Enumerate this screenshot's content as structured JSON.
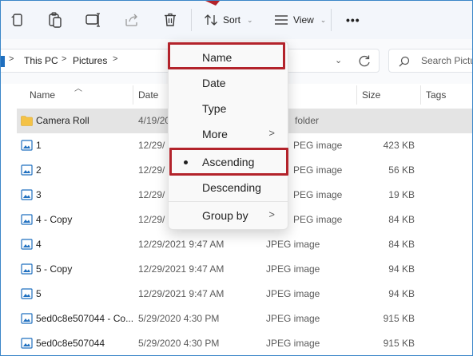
{
  "toolbar": {
    "icons": [
      "copy-icon",
      "paste-icon",
      "rename-icon",
      "share-icon",
      "delete-icon"
    ],
    "sort_label": "Sort",
    "view_label": "View",
    "more_label": "•••"
  },
  "address": {
    "crumbs": [
      "This PC",
      "Pictures"
    ],
    "separator": ">"
  },
  "search": {
    "placeholder": "Search Pictures"
  },
  "columns": {
    "name": "Name",
    "date": "Date",
    "size": "Size",
    "tags": "Tags"
  },
  "rows": [
    {
      "name": "Camera Roll",
      "date": "4/19/20",
      "type": "folder",
      "size": "",
      "kind": "folder"
    },
    {
      "name": "1",
      "date": "12/29/",
      "type": "PEG image",
      "size": "423 KB",
      "kind": "image"
    },
    {
      "name": "2",
      "date": "12/29/",
      "type": "PEG image",
      "size": "56 KB",
      "kind": "image"
    },
    {
      "name": "3",
      "date": "12/29/",
      "type": "PEG image",
      "size": "19 KB",
      "kind": "image"
    },
    {
      "name": "4 - Copy",
      "date": "12/29/",
      "type": "PEG image",
      "size": "84 KB",
      "kind": "image"
    },
    {
      "name": "4",
      "date": "12/29/2021 9:47 AM",
      "type": "JPEG image",
      "size": "84 KB",
      "kind": "image"
    },
    {
      "name": "5 - Copy",
      "date": "12/29/2021 9:47 AM",
      "type": "JPEG image",
      "size": "94 KB",
      "kind": "image"
    },
    {
      "name": "5",
      "date": "12/29/2021 9:47 AM",
      "type": "JPEG image",
      "size": "94 KB",
      "kind": "image"
    },
    {
      "name": "5ed0c8e507044 - Co...",
      "date": "5/29/2020 4:30 PM",
      "type": "JPEG image",
      "size": "915 KB",
      "kind": "image"
    },
    {
      "name": "5ed0c8e507044",
      "date": "5/29/2020 4:30 PM",
      "type": "JPEG image",
      "size": "915 KB",
      "kind": "image"
    }
  ],
  "sort_menu": {
    "name": "Name",
    "date": "Date",
    "type": "Type",
    "more": "More",
    "ascending": "Ascending",
    "descending": "Descending",
    "group_by": "Group by",
    "submenu_glyph": ">"
  },
  "colors": {
    "highlight": "#b3232b",
    "selected_row": "#e4e4e4",
    "folder": "#f4c246",
    "image_icon": "#1f6fbf"
  }
}
